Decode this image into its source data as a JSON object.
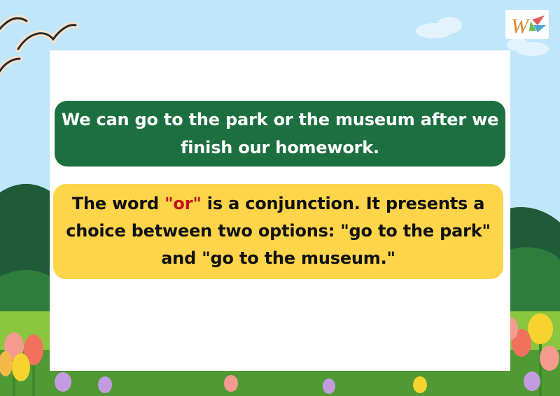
{
  "slide": {
    "example_sentence": "We can go to the park or the museum after we finish our homework.",
    "explanation": {
      "before": "The word ",
      "highlight": "\"or\"",
      "after": " is a conjunction. It presents a choice between two options: \"go to the park\" and \"go to the museum.\""
    }
  },
  "colors": {
    "sky": "#bfe6fb",
    "example_box": "#1c7040",
    "explanation_box": "#fdd44a",
    "highlight": "#c1121c"
  },
  "icons": [
    "bird-icon",
    "logo-icon",
    "cloud-icon",
    "tulip-icon"
  ]
}
